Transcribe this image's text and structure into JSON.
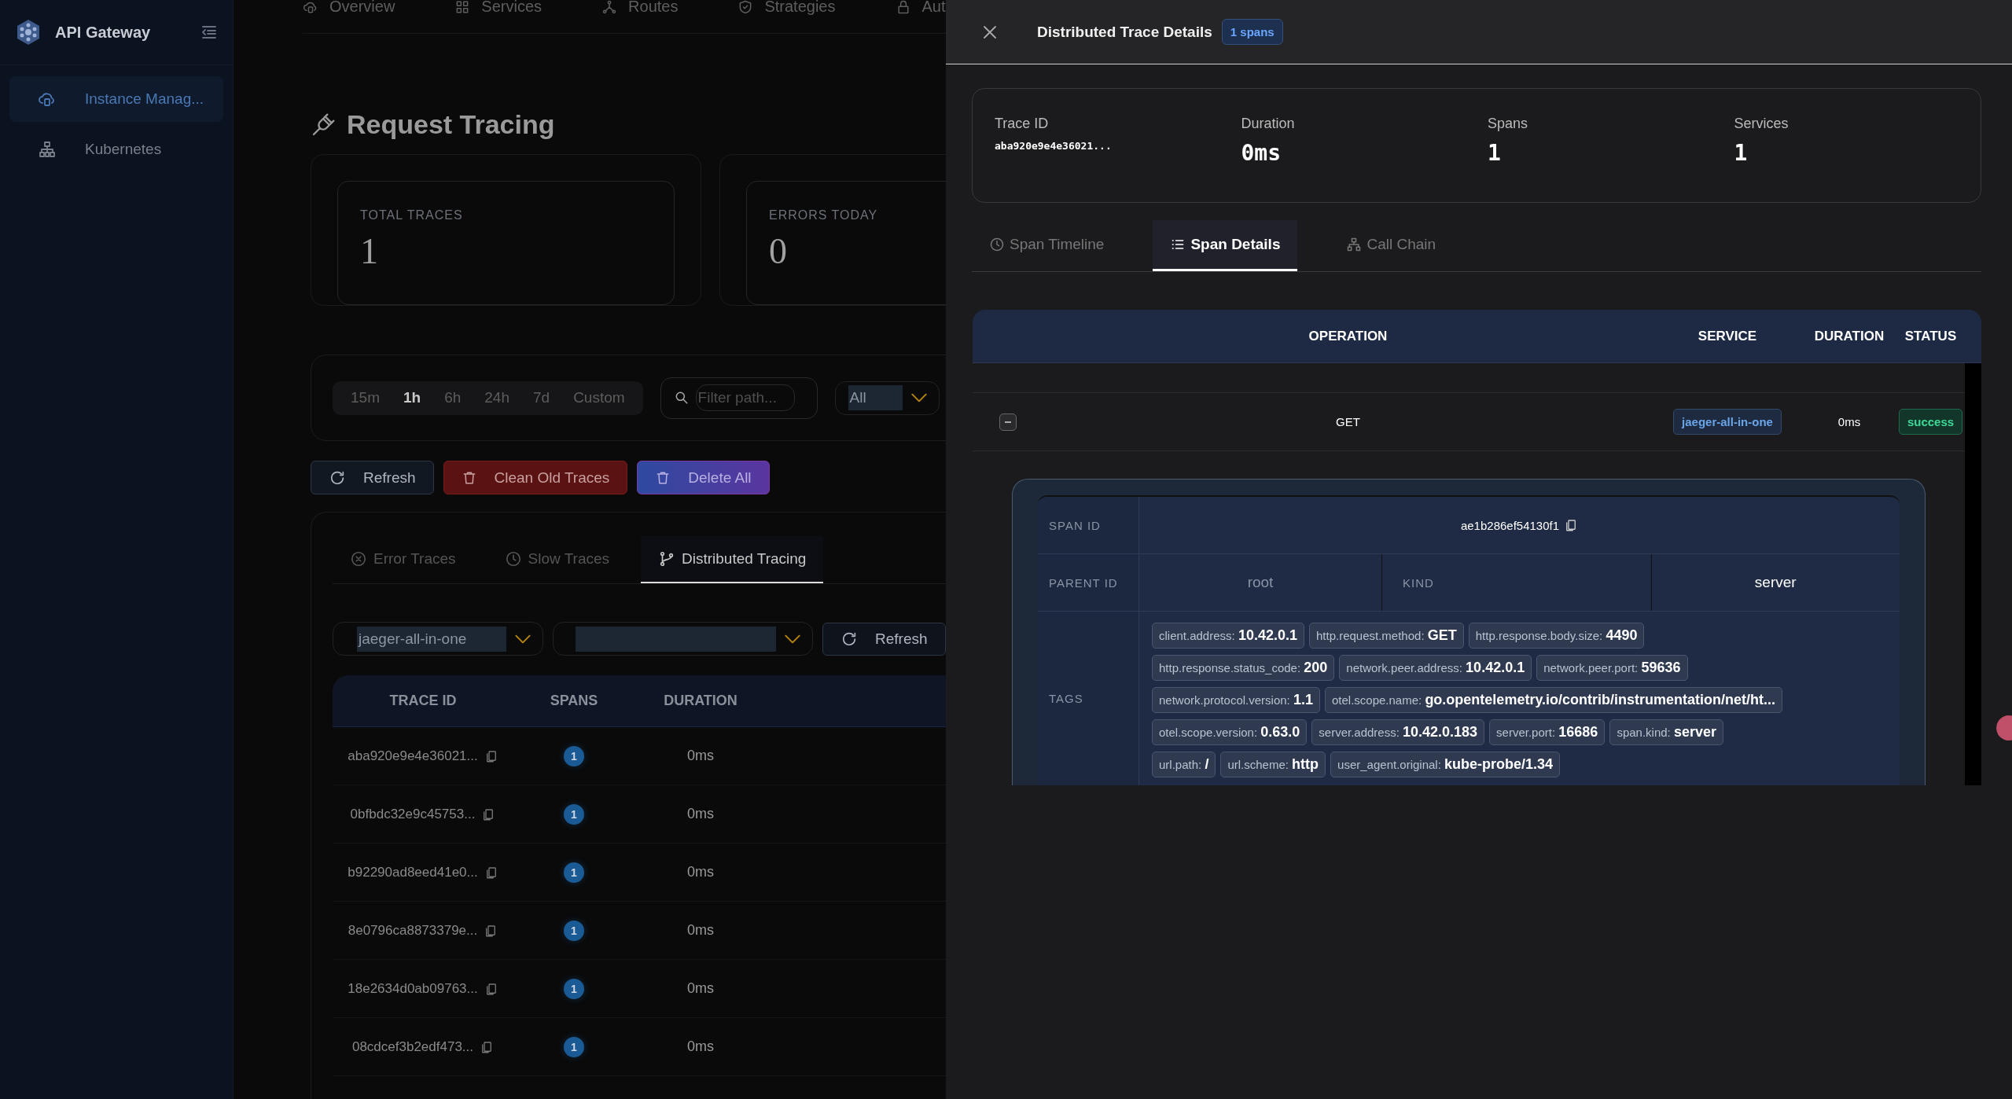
{
  "sidebar": {
    "brand": "API Gateway",
    "items": [
      {
        "label": "Instance Manag...",
        "selected": true,
        "kind": "cloud"
      },
      {
        "label": "Kubernetes",
        "selected": false,
        "kind": "cluster"
      }
    ]
  },
  "top_nav": [
    {
      "label": "Overview",
      "kind": "cloud"
    },
    {
      "label": "Services",
      "kind": "grid"
    },
    {
      "label": "Routes",
      "kind": "nodes"
    },
    {
      "label": "Strategies",
      "kind": "shield"
    },
    {
      "label": "Aut",
      "kind": "lock"
    }
  ],
  "page_title": "Request Tracing",
  "stats": [
    {
      "label": "TOTAL TRACES",
      "value": "1"
    },
    {
      "label": "ERRORS TODAY",
      "value": "0"
    }
  ],
  "time_ranges": [
    {
      "label": "15m",
      "selected": false
    },
    {
      "label": "1h",
      "selected": true
    },
    {
      "label": "6h",
      "selected": false
    },
    {
      "label": "24h",
      "selected": false
    },
    {
      "label": "7d",
      "selected": false
    },
    {
      "label": "Custom",
      "selected": false
    }
  ],
  "path_filter": {
    "placeholder": "Filter path..."
  },
  "status_select": {
    "value": "All"
  },
  "actions": [
    {
      "label": "Refresh",
      "kind": "default"
    },
    {
      "label": "Clean Old Traces",
      "kind": "danger"
    },
    {
      "label": "Delete All",
      "kind": "gradient"
    }
  ],
  "trace_tabs": [
    {
      "label": "Error Traces",
      "kind": "error",
      "selected": false
    },
    {
      "label": "Slow Traces",
      "kind": "slow",
      "selected": false
    },
    {
      "label": "Distributed Tracing",
      "kind": "distributed",
      "selected": true
    }
  ],
  "service_select": {
    "value": "jaeger-all-in-one"
  },
  "refresh_button": "Refresh",
  "trace_table": {
    "columns": [
      "TRACE ID",
      "SPANS",
      "DURATION"
    ],
    "rows": [
      {
        "trace_id": "aba920e9e4e36021...",
        "spans": "1",
        "duration": "0ms"
      },
      {
        "trace_id": "0bfbdc32e9c45753...",
        "spans": "1",
        "duration": "0ms"
      },
      {
        "trace_id": "b92290ad8eed41e0...",
        "spans": "1",
        "duration": "0ms"
      },
      {
        "trace_id": "8e0796ca8873379e...",
        "spans": "1",
        "duration": "0ms"
      },
      {
        "trace_id": "18e2634d0ab09763...",
        "spans": "1",
        "duration": "0ms"
      },
      {
        "trace_id": "08cdcef3b2edf473...",
        "spans": "1",
        "duration": "0ms"
      }
    ]
  },
  "drawer": {
    "title": "Distributed Trace Details",
    "badge": "1 spans",
    "summary": [
      {
        "label": "Trace ID",
        "value": "aba920e9e4e36021...",
        "kind": "id"
      },
      {
        "label": "Duration",
        "value": "0ms",
        "kind": "metric"
      },
      {
        "label": "Spans",
        "value": "1",
        "kind": "metric"
      },
      {
        "label": "Services",
        "value": "1",
        "kind": "metric"
      }
    ],
    "tabs": [
      {
        "label": "Span Timeline",
        "kind": "timeline",
        "selected": false
      },
      {
        "label": "Span Details",
        "kind": "list",
        "selected": true
      },
      {
        "label": "Call Chain",
        "kind": "chain",
        "selected": false
      }
    ],
    "span_table": {
      "columns": [
        "OPERATION",
        "SERVICE",
        "DURATION",
        "STATUS"
      ],
      "rows": [
        {
          "operation": "GET",
          "service": "jaeger-all-in-one",
          "duration": "0ms",
          "status": "success",
          "expanded": true
        }
      ]
    },
    "span_detail": {
      "span_id": {
        "label": "SPAN ID",
        "value": "ae1b286ef54130f1"
      },
      "parent_id": {
        "label": "PARENT ID",
        "value": "root"
      },
      "kind": {
        "label": "KIND",
        "value": "server"
      },
      "tags_label": "TAGS",
      "tag_rows": [
        [
          {
            "key": "client.address:",
            "value": "10.42.0.1"
          },
          {
            "key": "http.request.method:",
            "value": "GET"
          },
          {
            "key": "http.response.body.size:",
            "value": "4490"
          }
        ],
        [
          {
            "key": "http.response.status_code:",
            "value": "200"
          },
          {
            "key": "network.peer.address:",
            "value": "10.42.0.1"
          },
          {
            "key": "network.peer.port:",
            "value": "59636"
          }
        ],
        [
          {
            "key": "network.protocol.version:",
            "value": "1.1"
          },
          {
            "key": "otel.scope.name:",
            "value": "go.opentelemetry.io/contrib/instrumentation/net/ht..."
          }
        ],
        [
          {
            "key": "otel.scope.version:",
            "value": "0.63.0"
          },
          {
            "key": "server.address:",
            "value": "10.42.0.183"
          },
          {
            "key": "server.port:",
            "value": "16686"
          },
          {
            "key": "span.kind:",
            "value": "server"
          }
        ],
        [
          {
            "key": "url.path:",
            "value": "/"
          },
          {
            "key": "url.scheme:",
            "value": "http"
          },
          {
            "key": "user_agent.original:",
            "value": "kube-probe/1.34"
          }
        ]
      ]
    }
  }
}
